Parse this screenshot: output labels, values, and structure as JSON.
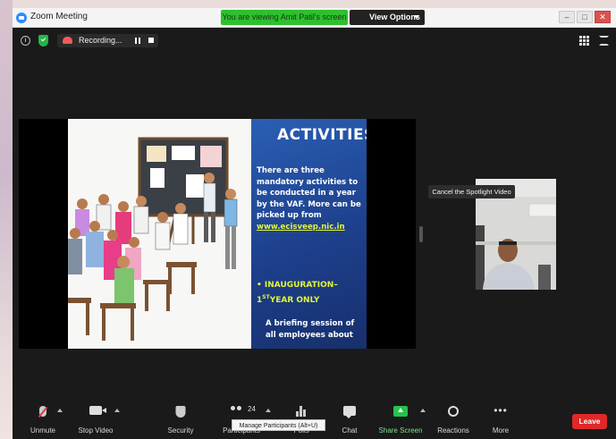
{
  "window": {
    "title": "Zoom Meeting",
    "viewing_banner": "You are viewing Amit Patil's screen",
    "view_options": "View Options",
    "controls": [
      "–",
      "□",
      "✕"
    ]
  },
  "recording": {
    "label": "Recording..."
  },
  "slide": {
    "heading": "ACTIVITIES",
    "body_text": "There are three mandatory activities to be conducted in a year by the VAF. More can be picked up from",
    "link": "www.ecisveep.nic.in",
    "bullet_prefix": "• INAUGURATION–",
    "bullet_line2_num": "1",
    "bullet_line2_sup": "ST",
    "bullet_line2_rest": "YEAR ONLY",
    "sub_text": "A briefing session of all employees about"
  },
  "spotlight": {
    "tooltip": "Cancel the Spotlight Video"
  },
  "toolbar": {
    "unmute": "Unmute",
    "stop_video": "Stop Video",
    "security": "Security",
    "participants": "Participants",
    "participants_count": "24",
    "polls": "Polls",
    "chat": "Chat",
    "share_screen": "Share Screen",
    "reactions": "Reactions",
    "more": "More",
    "leave": "Leave",
    "manage_tooltip": "Manage Participants (Alt+U)"
  },
  "icons": {
    "app": "zoom-logo-icon",
    "info": "info-icon",
    "encryption": "shield-icon",
    "recording": "cloud-record-icon",
    "pause": "pause-icon",
    "stop": "stop-icon",
    "grid": "grid-view-icon",
    "fullscreen": "fullscreen-icon"
  },
  "colors": {
    "banner_green": "#2fbf2f",
    "leave_red": "#e02828",
    "share_green": "#27c24c",
    "slide_blue": "#1d3f8c",
    "slide_yellow": "#e2f23a"
  }
}
